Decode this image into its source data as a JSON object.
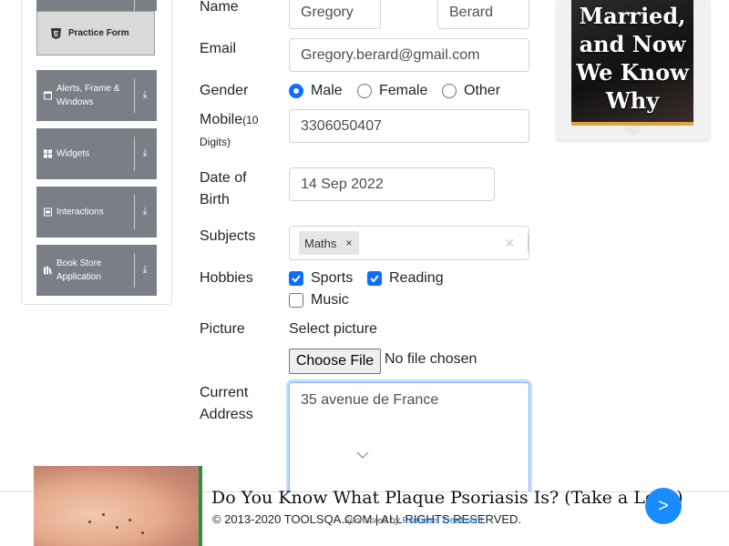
{
  "sidebar": {
    "active_item": "Practice Form",
    "groups": [
      {
        "label": "Alerts, Frame & Windows",
        "icon": "window-icon"
      },
      {
        "label": "Widgets",
        "icon": "grid-icon"
      },
      {
        "label": "Interactions",
        "icon": "square-icon"
      },
      {
        "label": "Book Store Application",
        "icon": "books-icon"
      }
    ]
  },
  "form": {
    "name_label": "Name",
    "first_name": "Gregory",
    "last_name": "Berard",
    "email_label": "Email",
    "email": "Gregory.berard@gmail.com",
    "gender_label": "Gender",
    "gender_options": [
      "Male",
      "Female",
      "Other"
    ],
    "gender_selected": "Male",
    "mobile_label": "Mobile",
    "mobile_hint": "(10 Digits)",
    "mobile": "3306050407",
    "dob_label": "Date of Birth",
    "dob": "14 Sep 2022",
    "subjects_label": "Subjects",
    "subject_chip": "Maths",
    "subject_chip_remove": "×",
    "subjects_clear": "×",
    "hobbies_label": "Hobbies",
    "hobbies": [
      {
        "label": "Sports",
        "checked": true
      },
      {
        "label": "Reading",
        "checked": true
      },
      {
        "label": "Music",
        "checked": false
      }
    ],
    "picture_label": "Picture",
    "picture_prompt": "Select picture",
    "file_button": "Choose File",
    "file_status": "No file chosen",
    "address_label": "Current Address",
    "address": "35 avenue de France"
  },
  "right_ad": {
    "text": "Married, and Now We Know Why"
  },
  "bottom_ad": {
    "headline": "Do You Know What Plaque Psoriasis Is? (Take a Look)",
    "sponsored_prefix": "Sponsored by",
    "sponsor": "Psoriasis Treatment",
    "next_label": ">"
  },
  "footer": {
    "copyright": "© 2013-2020 TOOLSQA.COM | ALL RIGHTS RESERVED."
  },
  "colors": {
    "accent": "#0d6efd",
    "sidebar_group": "#7a7f87",
    "ad_next": "#1a8cff"
  }
}
